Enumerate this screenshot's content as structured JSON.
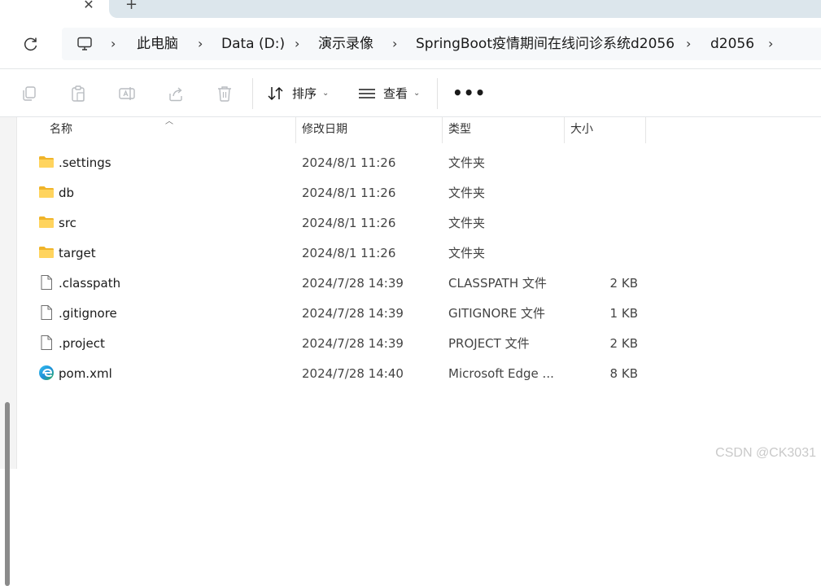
{
  "tabs": {
    "close_glyph": "✕",
    "new_tab_glyph": "+"
  },
  "breadcrumb": [
    {
      "label": "此电脑"
    },
    {
      "label": "Data (D:)"
    },
    {
      "label": "演示录像"
    },
    {
      "label": "SpringBoot疫情期间在线问诊系统d2056"
    },
    {
      "label": "d2056"
    }
  ],
  "breadcrumb_separator": "›",
  "toolbar": {
    "sort_label": "排序",
    "view_label": "查看",
    "more_label": "•••",
    "icons": [
      "copy-icon",
      "paste-icon",
      "rename-icon",
      "share-icon",
      "delete-icon"
    ]
  },
  "columns": {
    "name": "名称",
    "date": "修改日期",
    "type": "类型",
    "size": "大小"
  },
  "files": [
    {
      "name": ".settings",
      "date": "2024/8/1 11:26",
      "type": "文件夹",
      "size": "",
      "icon": "folder-icon"
    },
    {
      "name": "db",
      "date": "2024/8/1 11:26",
      "type": "文件夹",
      "size": "",
      "icon": "folder-icon"
    },
    {
      "name": "src",
      "date": "2024/8/1 11:26",
      "type": "文件夹",
      "size": "",
      "icon": "folder-icon"
    },
    {
      "name": "target",
      "date": "2024/8/1 11:26",
      "type": "文件夹",
      "size": "",
      "icon": "folder-icon"
    },
    {
      "name": ".classpath",
      "date": "2024/7/28 14:39",
      "type": "CLASSPATH 文件",
      "size": "2 KB",
      "icon": "file-icon"
    },
    {
      "name": ".gitignore",
      "date": "2024/7/28 14:39",
      "type": "GITIGNORE 文件",
      "size": "1 KB",
      "icon": "file-icon"
    },
    {
      "name": ".project",
      "date": "2024/7/28 14:39",
      "type": "PROJECT 文件",
      "size": "2 KB",
      "icon": "file-icon"
    },
    {
      "name": "pom.xml",
      "date": "2024/7/28 14:40",
      "type": "Microsoft Edge ...",
      "size": "8 KB",
      "icon": "edge-icon"
    }
  ],
  "watermark": "CSDN @CK3031",
  "colors": {
    "folder": "#f5c244",
    "accent": "#0b74c8"
  }
}
